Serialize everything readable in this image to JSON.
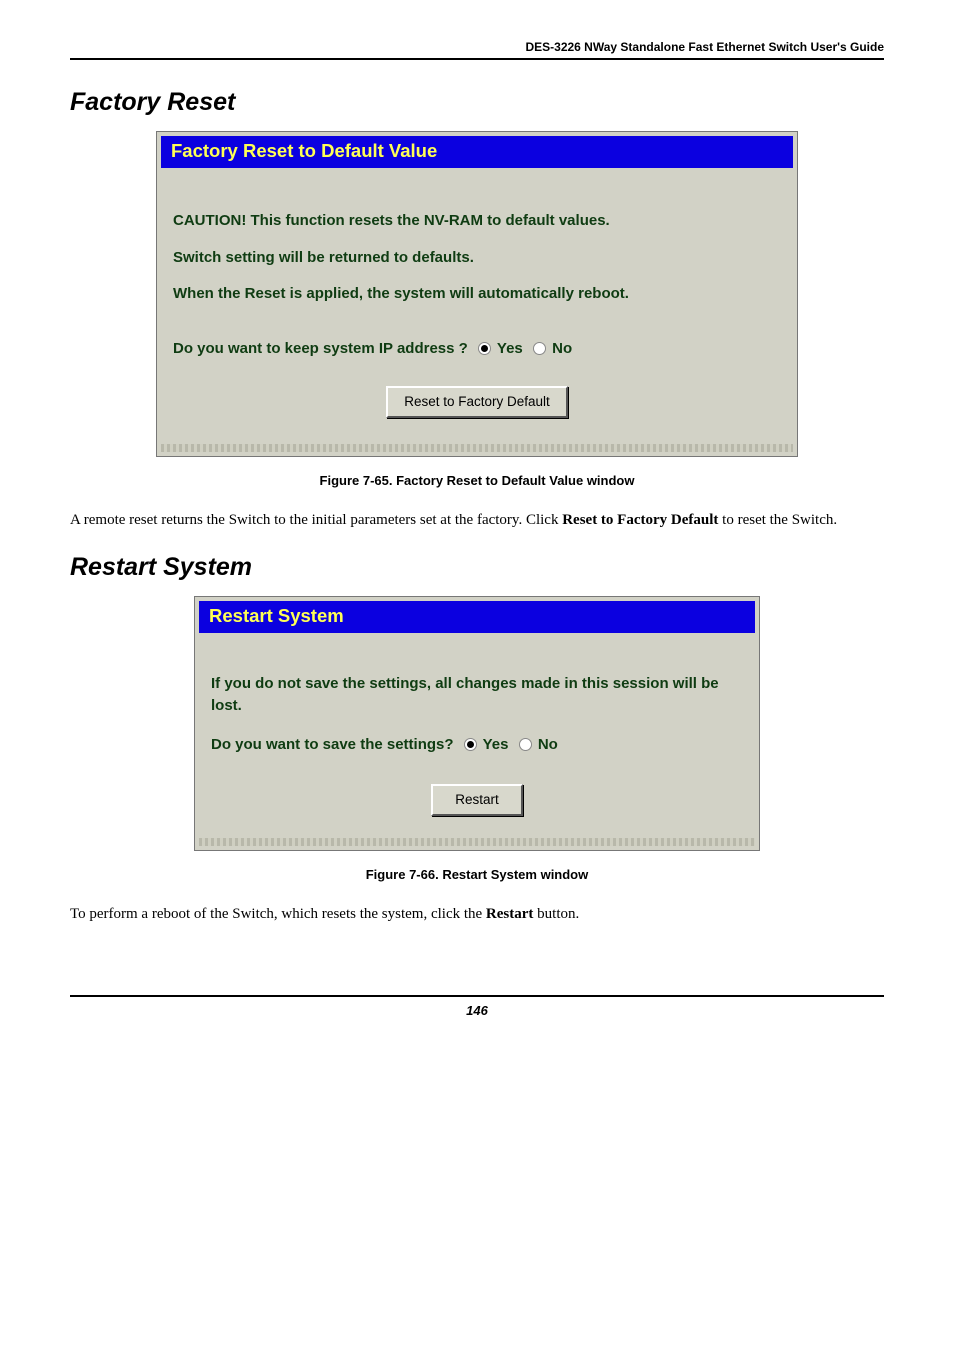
{
  "header": {
    "title": "DES-3226 NWay Standalone Fast Ethernet Switch User's Guide"
  },
  "section1": {
    "heading": "Factory Reset",
    "panel": {
      "title": "Factory Reset to Default Value",
      "caution": "CAUTION! This function resets the NV-RAM to default values.",
      "line2": "Switch setting will be returned to defaults.",
      "line3": "When the Reset is applied, the system will automatically reboot.",
      "question": "Do you want to keep system IP address ?",
      "yes": "Yes",
      "no": "No",
      "button": "Reset to Factory Default"
    },
    "caption": "Figure 7-65.  Factory Reset to Default Value window",
    "para_before": "A remote reset returns the Switch to the initial parameters set at the factory. Click ",
    "para_bold": "Reset to Factory Default",
    "para_after": " to reset the Switch."
  },
  "section2": {
    "heading": "Restart System",
    "panel": {
      "title": "Restart System",
      "warn": "If you do not save the settings, all changes made in this session will be lost.",
      "question": "Do you want to save the settings?",
      "yes": "Yes",
      "no": "No",
      "button": "Restart"
    },
    "caption": "Figure 7-66.  Restart System window",
    "para_before": "To perform a reboot of the Switch, which resets the system, click the ",
    "para_bold": "Restart",
    "para_after": " button."
  },
  "footer": {
    "page": "146"
  }
}
